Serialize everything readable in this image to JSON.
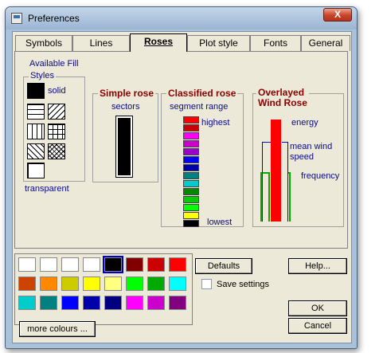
{
  "window": {
    "title": "Preferences",
    "close_label": "X"
  },
  "tabs": [
    {
      "label": "Symbols"
    },
    {
      "label": "Lines"
    },
    {
      "label": "Roses",
      "active": true
    },
    {
      "label": "Plot style"
    },
    {
      "label": "Fonts"
    },
    {
      "label": "General"
    }
  ],
  "fill": {
    "available_fill": "Available Fill",
    "styles_label": "Styles",
    "solid": "solid",
    "transparent": "transparent"
  },
  "simple_rose": {
    "title": "Simple rose",
    "sectors": "sectors"
  },
  "classified_rose": {
    "title": "Classified rose",
    "range_label": "segment range",
    "highest": "highest",
    "lowest": "lowest",
    "segments": [
      "#ff0000",
      "#cc0000",
      "#ff00ff",
      "#cc00cc",
      "#9900cc",
      "#0000ff",
      "#0000aa",
      "#008080",
      "#00cccc",
      "#008800",
      "#00cc00",
      "#00ff00",
      "#ffff00",
      "#000000"
    ]
  },
  "overlayed_rose": {
    "title_line1": "Overlayed",
    "title_line2": "Wind Rose",
    "energy": "energy",
    "mean_wind": "mean wind",
    "speed": "speed",
    "frequency": "frequency",
    "colors": {
      "energy": "#ff0000",
      "mean": "#0000cc",
      "frequency": "#00aa00"
    }
  },
  "palette": {
    "colors": [
      "#ffffff",
      "#ffffff",
      "#ffffff",
      "#ffffff",
      "#000000",
      "#800000",
      "#cc0000",
      "#ff0000",
      "#cc4400",
      "#ff8800",
      "#cccc00",
      "#ffff00",
      "#ffff80",
      "#00ff00",
      "#00aa00",
      "#00ffff",
      "#00cccc",
      "#008080",
      "#0000ff",
      "#0000aa",
      "#000080",
      "#ff00ff",
      "#cc00cc",
      "#800080"
    ],
    "more_colours": "more colours ..."
  },
  "buttons": {
    "defaults": "Defaults",
    "help": "Help...",
    "ok": "OK",
    "cancel": "Cancel"
  },
  "save_settings": "Save settings"
}
